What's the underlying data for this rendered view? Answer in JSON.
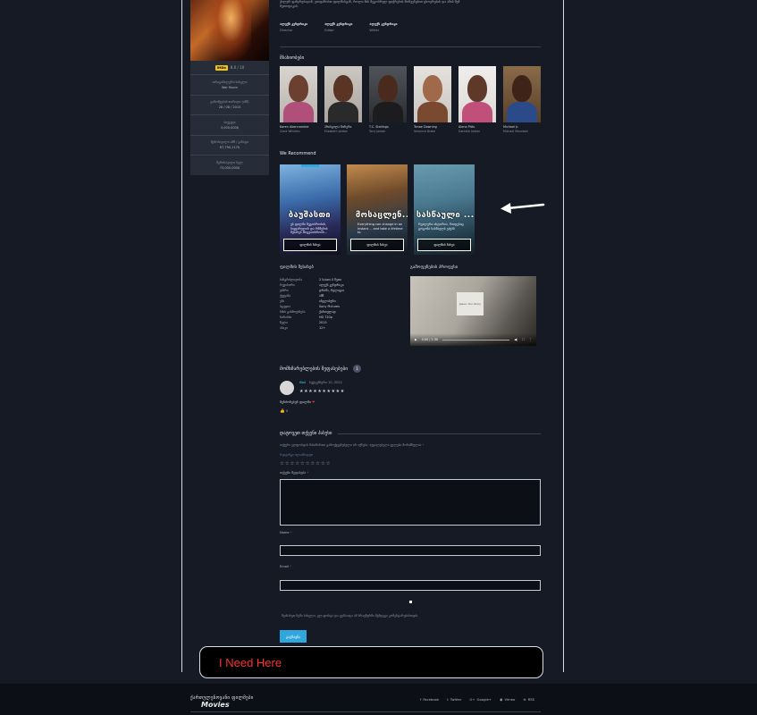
{
  "sidebar": {
    "rating": "8.0 / 10",
    "imdb_label": "IMDb",
    "rows": [
      {
        "label": "ორიგინალური სახელი",
        "value": "War Room"
      },
      {
        "label": "გამოშვების თარიღი (აშშ)",
        "value": "28 / 08 / 2015"
      },
      {
        "label": "ბიუჯეტი",
        "value": "3,000,000$"
      },
      {
        "label": "შემოსავალი აშშ / კანადა",
        "value": "67,790,117$"
      },
      {
        "label": "შემოსავალი სულ",
        "value": "73,000,000$"
      }
    ]
  },
  "main": {
    "synopsis": "ქალურ ფანჯრებიდან, ვთავაზობთ ფილმისგან, როლი მის მეგობრულ ფიქრების მოჩვენებით ცხოვრების და ამის შემ მეთოდიკას.",
    "crew": [
      {
        "name": "ალექს კენდრიკი",
        "role": "Director"
      },
      {
        "name": "ალექს კენდრიკი",
        "role": "Editor"
      },
      {
        "name": "ალექს კენდრიკი",
        "role": "Writer"
      }
    ],
    "cast_title": "მსახიობები",
    "cast": [
      {
        "name": "Karen Abercrombie",
        "role": "Clara Williams"
      },
      {
        "name": "პრისცილა შირერი",
        "role": "Elizabeth Jordan"
      },
      {
        "name": "T.C. Stallings",
        "role": "Tony Jordan"
      },
      {
        "name": "Tenae Downing",
        "role": "Veronica Drake"
      },
      {
        "name": "Alena Pitts",
        "role": "Danielle Jordan"
      },
      {
        "name": "Michael Jr.",
        "role": "Michael Mountain"
      }
    ],
    "recommend_title": "We Recommend",
    "recommendations": [
      {
        "title": "ბაუშასთი",
        "desc": "ეს ფილმი მეგობრობის, სიყვარულის და რწმენის შესახებ მოგვითხრობს...",
        "button": "ფილმის ნახვა"
      },
      {
        "title": "მოსაცლენ...",
        "desc": "Everything can change in an instant ... and take a lifetime to",
        "button": "ფილმის ნახვა"
      },
      {
        "title": "სასწაული ...",
        "desc": "რეალური ისტორია, როდესაც გოგონა სასწაულს ეძებს",
        "button": "ფილმის ნახვა"
      }
    ],
    "info_title": "ფილმის შესახებ",
    "info": [
      {
        "k": "ხანგრძლივობა",
        "v": "2 საათი 0 წუთი"
      },
      {
        "k": "რეჟისორი",
        "v": "ალექს კენდრიკი"
      },
      {
        "k": "ჟანრი",
        "v": "დრამა, რელიგია"
      },
      {
        "k": "ქვეყანა",
        "v": "აშშ"
      },
      {
        "k": "ენა",
        "v": "ინგლისური"
      },
      {
        "k": "სტუდია",
        "v": "Sony Pictures"
      },
      {
        "k": "ხმის გახმოვანება",
        "v": "ქართულად"
      },
      {
        "k": "ხარისხი",
        "v": "HD 720p"
      },
      {
        "k": "წელი",
        "v": "2015"
      },
      {
        "k": "ასაკი",
        "v": "12+"
      }
    ],
    "trailer_title": "გამოფენების პროფესი",
    "video": {
      "time": "0:00 / 1:30",
      "sign_text": "Jesus, Our Glory"
    }
  },
  "comments": {
    "title": "მომხმარებლების შეფასებები",
    "count": "1",
    "author": "GuI",
    "date": "სექტემბერი 10, 2021",
    "stars": "★★★★★★★★★★",
    "text": "მენძონებენ ფილმი",
    "heart": "❤",
    "likes": "0"
  },
  "reply": {
    "title": "დატოვეთ თქვენი პასუხი",
    "note": "თქვენი ელფოსტის მისამართი გამოქვეყნებული არ იქნება. აუცილებელი ველები მონიშნულია",
    "req_mark": "*",
    "rate_label": "რეიტინგი ილიაწოდეთ",
    "rate_stars": "☆☆☆☆☆☆☆☆☆☆",
    "comment_label": "თქვენი შეფასება",
    "name_label": "Name",
    "email_label": "Email",
    "save_note": "შეინახეთ ჩემი სახელი, ელ.ფოსტა და ვებსაიტი ამ ბრაუზერში შემდეგი კომენტარებისთვის.",
    "submit": "გაგზავნა"
  },
  "overlay": {
    "text": "I Need Here"
  },
  "footer": {
    "logo_top": "ქართულენოვანი ფილმები",
    "logo_bottom": "Movies",
    "social": [
      {
        "icon": "f",
        "label": "Facebook"
      },
      {
        "icon": "t",
        "label": "Twitter"
      },
      {
        "icon": "G+",
        "label": "Google+"
      },
      {
        "icon": "◉",
        "label": "Vimeo"
      },
      {
        "icon": "≋",
        "label": "RSS"
      }
    ]
  }
}
